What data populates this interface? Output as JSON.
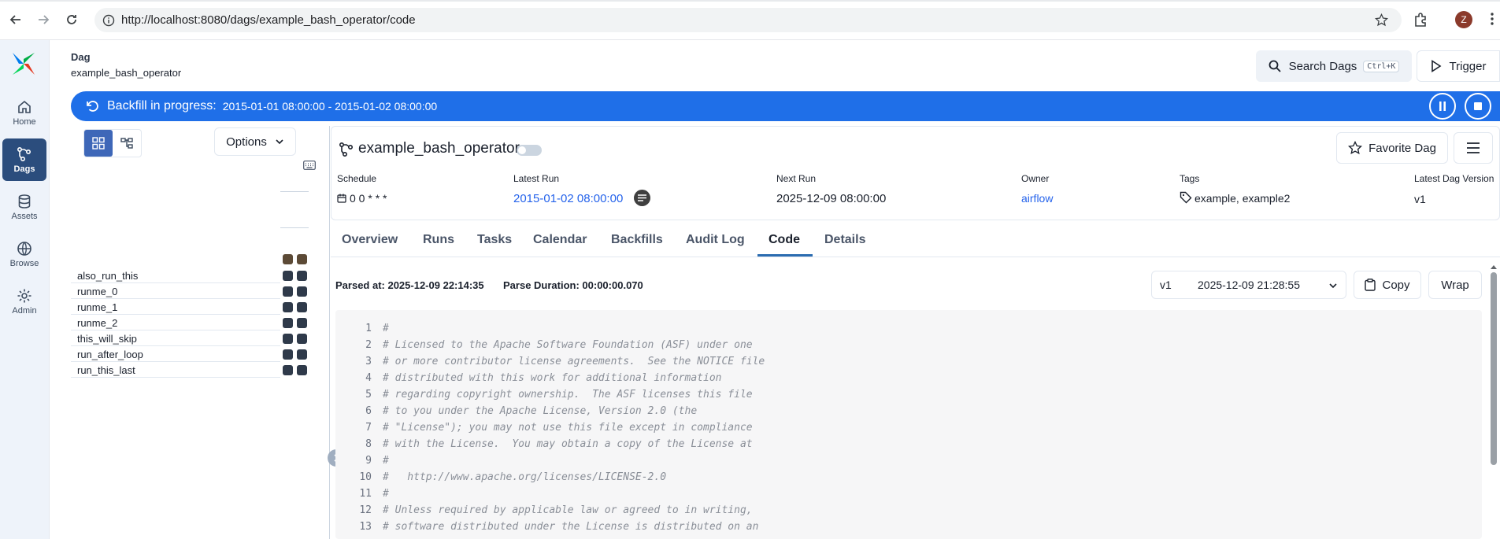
{
  "browser": {
    "url": "http://localhost:8080/dags/example_bash_operator/code",
    "profile_initial": "Z"
  },
  "nav": {
    "items": [
      {
        "label": "Home"
      },
      {
        "label": "Dags"
      },
      {
        "label": "Assets"
      },
      {
        "label": "Browse"
      },
      {
        "label": "Admin"
      }
    ]
  },
  "header": {
    "dag_label": "Dag",
    "dag_id": "example_bash_operator",
    "search_label": "Search Dags",
    "search_shortcut": "Ctrl+K",
    "trigger_label": "Trigger"
  },
  "banner": {
    "title": "Backfill in progress:",
    "range": "2015-01-01 08:00:00 - 2015-01-02 08:00:00"
  },
  "grid": {
    "options_label": "Options",
    "tasks": [
      "also_run_this",
      "runme_0",
      "runme_1",
      "runme_2",
      "this_will_skip",
      "run_after_loop",
      "run_this_last"
    ]
  },
  "dag": {
    "title": "example_bash_operator",
    "favorite_label": "Favorite Dag",
    "schedule_label": "Schedule",
    "schedule_value": "0 0 * * *",
    "latest_run_label": "Latest Run",
    "latest_run_value": "2015-01-02 08:00:00",
    "next_run_label": "Next Run",
    "next_run_value": "2025-12-09 08:00:00",
    "owner_label": "Owner",
    "owner_value": "airflow",
    "tags_label": "Tags",
    "tags_value": "example, example2",
    "version_label": "Latest Dag Version",
    "version_value": "v1"
  },
  "tabs": [
    "Overview",
    "Runs",
    "Tasks",
    "Calendar",
    "Backfills",
    "Audit Log",
    "Code",
    "Details"
  ],
  "active_tab": "Code",
  "code_view": {
    "parsed_at": "Parsed at: 2025-12-09 22:14:35",
    "parse_duration": "Parse Duration: 00:00:00.070",
    "version": "v1",
    "version_date": "2025-12-09 21:28:55",
    "copy_label": "Copy",
    "wrap_label": "Wrap",
    "lines": [
      "#",
      "# Licensed to the Apache Software Foundation (ASF) under one",
      "# or more contributor license agreements.  See the NOTICE file",
      "# distributed with this work for additional information",
      "# regarding copyright ownership.  The ASF licenses this file",
      "# to you under the Apache License, Version 2.0 (the",
      "# \"License\"); you may not use this file except in compliance",
      "# with the License.  You may obtain a copy of the License at",
      "#",
      "#   http://www.apache.org/licenses/LICENSE-2.0",
      "#",
      "# Unless required by applicable law or agreed to in writing,",
      "# software distributed under the License is distributed on an"
    ]
  },
  "colors": {
    "banner": "#1f6fe8",
    "nav_active": "#2b4d7d",
    "link": "#2563eb"
  }
}
